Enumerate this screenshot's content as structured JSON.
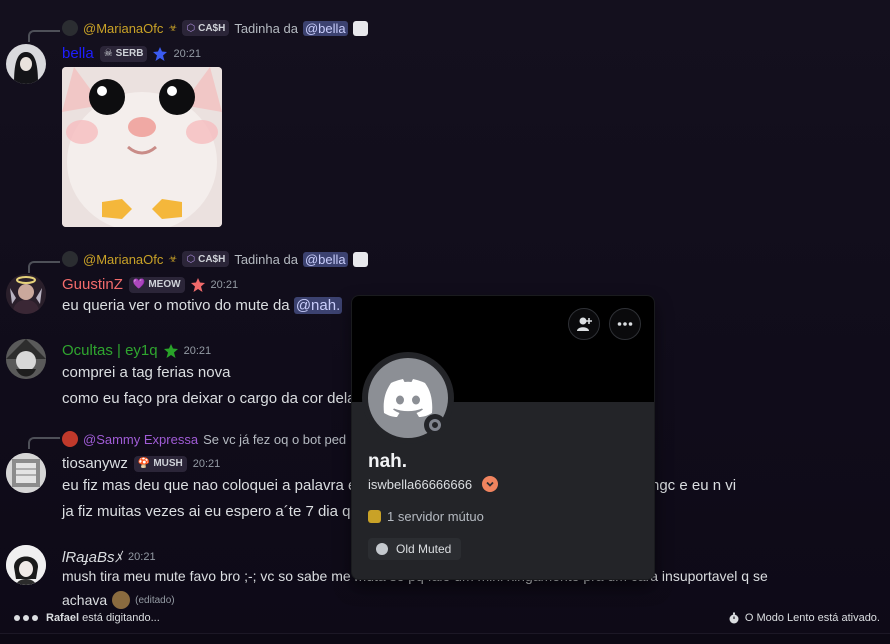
{
  "messages": [
    {
      "reply": {
        "author": "@MarianaOfc",
        "tag": "CA$H",
        "text": "Tadinha da",
        "mention": "@bella"
      },
      "author": "bella",
      "author_color": "#1e1eff",
      "tag": "SERB",
      "time": "20:21"
    },
    {
      "reply": {
        "author": "@MarianaOfc",
        "tag": "CA$H",
        "text": "Tadinha da",
        "mention": "@bella"
      },
      "author": "GuustinZ",
      "author_color": "#f26b6b",
      "tag": "MEOW",
      "time": "20:21",
      "text": "eu queria ver o motivo do mute da",
      "mention": "@nah."
    },
    {
      "author": "Ocultas | ey1q",
      "author_color": "#2fa52f",
      "time": "20:21",
      "lines": [
        "comprei a tag ferias nova",
        "como eu faço pra deixar o cargo da cor dela"
      ]
    },
    {
      "reply": {
        "author": "@Sammy Expressa",
        "text": "Se vc já fez oq o bot ped"
      },
      "author": "tiosanywz",
      "author_color": "#dbdee1",
      "tag": "MUSH",
      "time": "20:21",
      "lines": [
        "eu fiz mas deu que nao coloquei a palavra e",
        "ja fiz muitas vezes ai eu espero a´te 7 dia qu"
      ],
      "trailing": "ngc e eu n vi"
    },
    {
      "author": "ɫRaɟaBsﾒ",
      "author_color": "#dbdee1",
      "time": "20:21",
      "text": "mush tira meu mute favo bro ;-; vc so sabe me muta so pq falo um mini xingamento pra um cara insuportavel q se",
      "text2": "achava",
      "edited": "(editado)"
    }
  ],
  "popout": {
    "display_name": "nah.",
    "username": "iswbella66666666",
    "mutual": "1 servidor mútuo",
    "role": "Old Muted"
  },
  "footer": {
    "typing": "Rafael",
    "typing_suffix": "está digitando...",
    "slowmode": "O Modo Lento está ativado."
  },
  "colors": {
    "reply_author": "#c9a227",
    "sammy": "#a05cd6",
    "role_dot": "#c4c9ce",
    "nitro": "#f0845f"
  },
  "icons": [
    "skull-icon",
    "star-badge-icon",
    "add-friend-icon",
    "more-icon",
    "discord-logo-icon",
    "timer-icon"
  ]
}
